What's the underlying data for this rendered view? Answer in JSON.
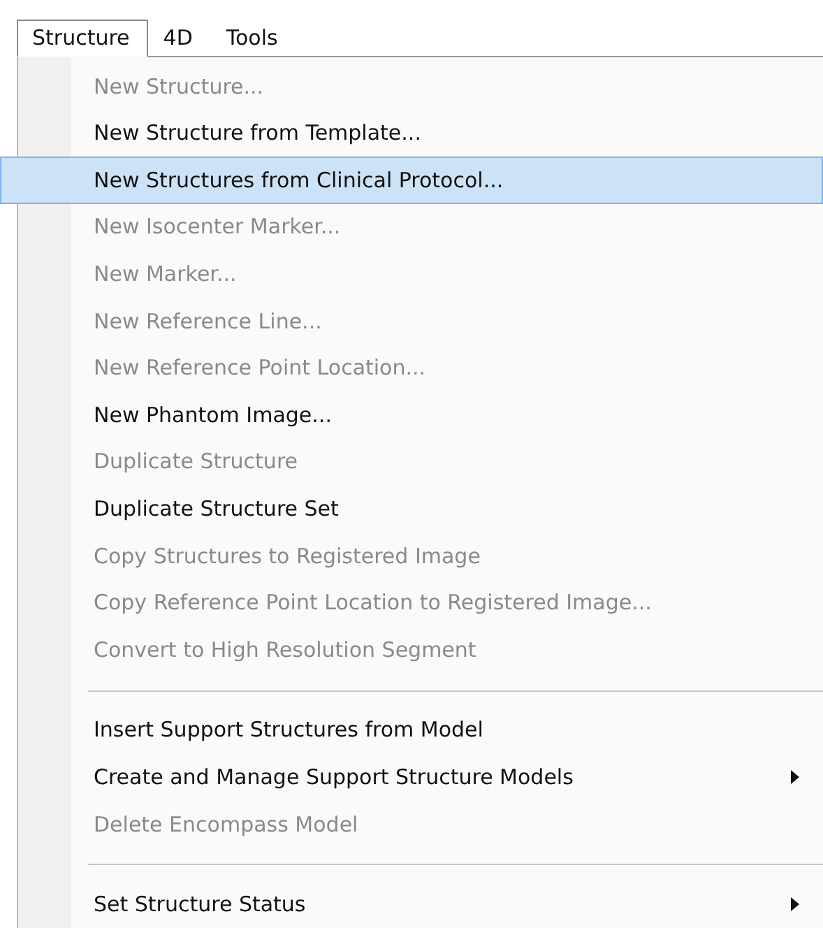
{
  "menu_bar": [
    {
      "label": "Structure",
      "selected": true
    },
    {
      "label": "4D",
      "selected": false
    },
    {
      "label": "Tools",
      "selected": false
    }
  ],
  "menu": {
    "items": [
      {
        "kind": "item",
        "label": "New Structure...",
        "disabled": true,
        "selected": false,
        "submenu": false
      },
      {
        "kind": "item",
        "label": "New Structure from Template...",
        "disabled": false,
        "selected": false,
        "submenu": false
      },
      {
        "kind": "item",
        "label": "New Structures from Clinical Protocol...",
        "disabled": false,
        "selected": true,
        "submenu": false
      },
      {
        "kind": "item",
        "label": "New Isocenter Marker...",
        "disabled": true,
        "selected": false,
        "submenu": false
      },
      {
        "kind": "item",
        "label": "New Marker...",
        "disabled": true,
        "selected": false,
        "submenu": false
      },
      {
        "kind": "item",
        "label": "New Reference Line...",
        "disabled": true,
        "selected": false,
        "submenu": false
      },
      {
        "kind": "item",
        "label": "New Reference Point Location...",
        "disabled": true,
        "selected": false,
        "submenu": false
      },
      {
        "kind": "item",
        "label": "New Phantom Image...",
        "disabled": false,
        "selected": false,
        "submenu": false
      },
      {
        "kind": "item",
        "label": "Duplicate Structure",
        "disabled": true,
        "selected": false,
        "submenu": false
      },
      {
        "kind": "item",
        "label": "Duplicate Structure Set",
        "disabled": false,
        "selected": false,
        "submenu": false
      },
      {
        "kind": "item",
        "label": "Copy Structures to Registered Image",
        "disabled": true,
        "selected": false,
        "submenu": false
      },
      {
        "kind": "item",
        "label": "Copy Reference Point Location to Registered Image...",
        "disabled": true,
        "selected": false,
        "submenu": false
      },
      {
        "kind": "item",
        "label": "Convert to High Resolution Segment",
        "disabled": true,
        "selected": false,
        "submenu": false
      },
      {
        "kind": "separator"
      },
      {
        "kind": "item",
        "label": "Insert Support Structures from Model",
        "disabled": false,
        "selected": false,
        "submenu": false
      },
      {
        "kind": "item",
        "label": "Create and Manage Support Structure Models",
        "disabled": false,
        "selected": false,
        "submenu": true
      },
      {
        "kind": "item",
        "label": "Delete Encompass Model",
        "disabled": true,
        "selected": false,
        "submenu": false
      },
      {
        "kind": "separator"
      },
      {
        "kind": "item",
        "label": "Set Structure Status",
        "disabled": false,
        "selected": false,
        "submenu": true
      }
    ]
  }
}
